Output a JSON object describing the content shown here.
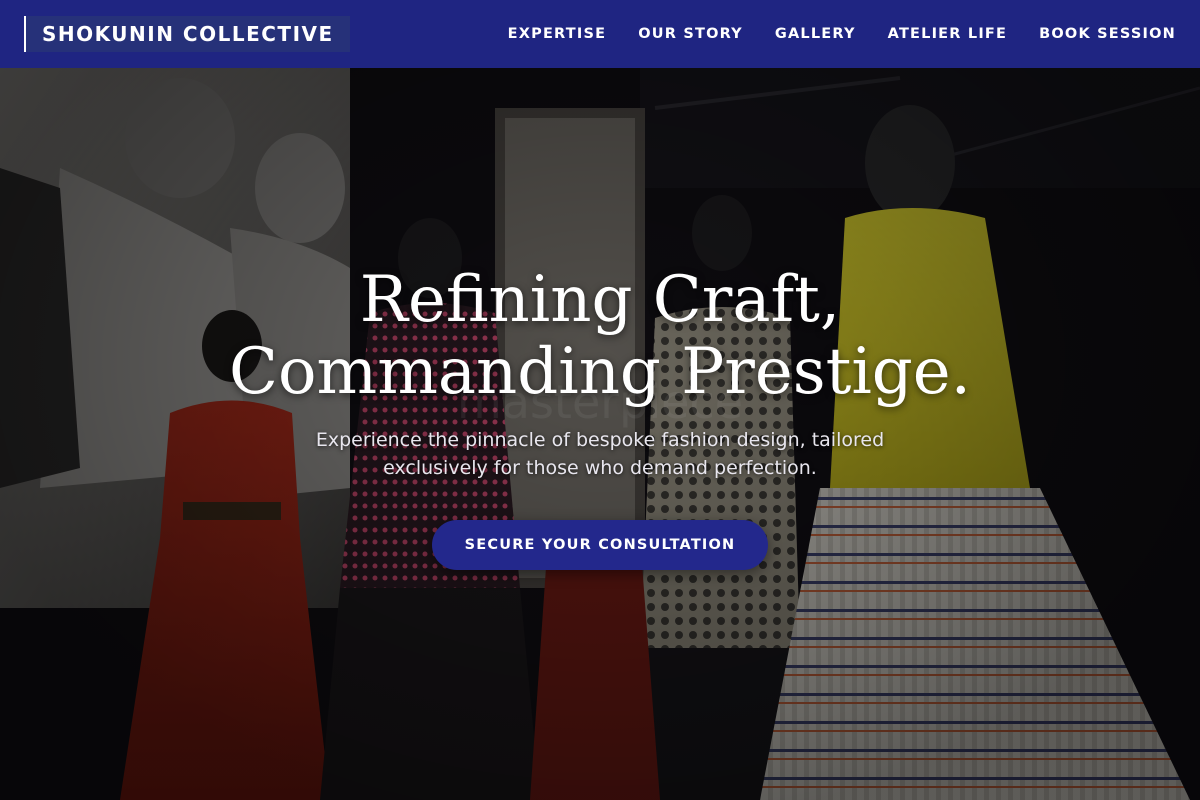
{
  "brand": {
    "name": "SHOKUNIN COLLECTIVE"
  },
  "nav": {
    "items": [
      {
        "label": "EXPERTISE"
      },
      {
        "label": "OUR STORY"
      },
      {
        "label": "GALLERY"
      },
      {
        "label": "ATELIER LIFE"
      },
      {
        "label": "BOOK SESSION"
      }
    ]
  },
  "hero": {
    "headline_line1": "Refining Craft,",
    "headline_line2": "Commanding Prestige.",
    "subline_line1": "Experience the pinnacle of bespoke fashion design, tailored",
    "subline_line2": "exclusively for those who demand perfection.",
    "cta_label": "SECURE YOUR CONSULTATION",
    "image": {
      "subject": "exhibition-of-couture-dresses-on-mannequins"
    }
  },
  "colors": {
    "header_bg": "#1f2582",
    "cta_bg": "#23288c",
    "text": "#ffffff"
  }
}
